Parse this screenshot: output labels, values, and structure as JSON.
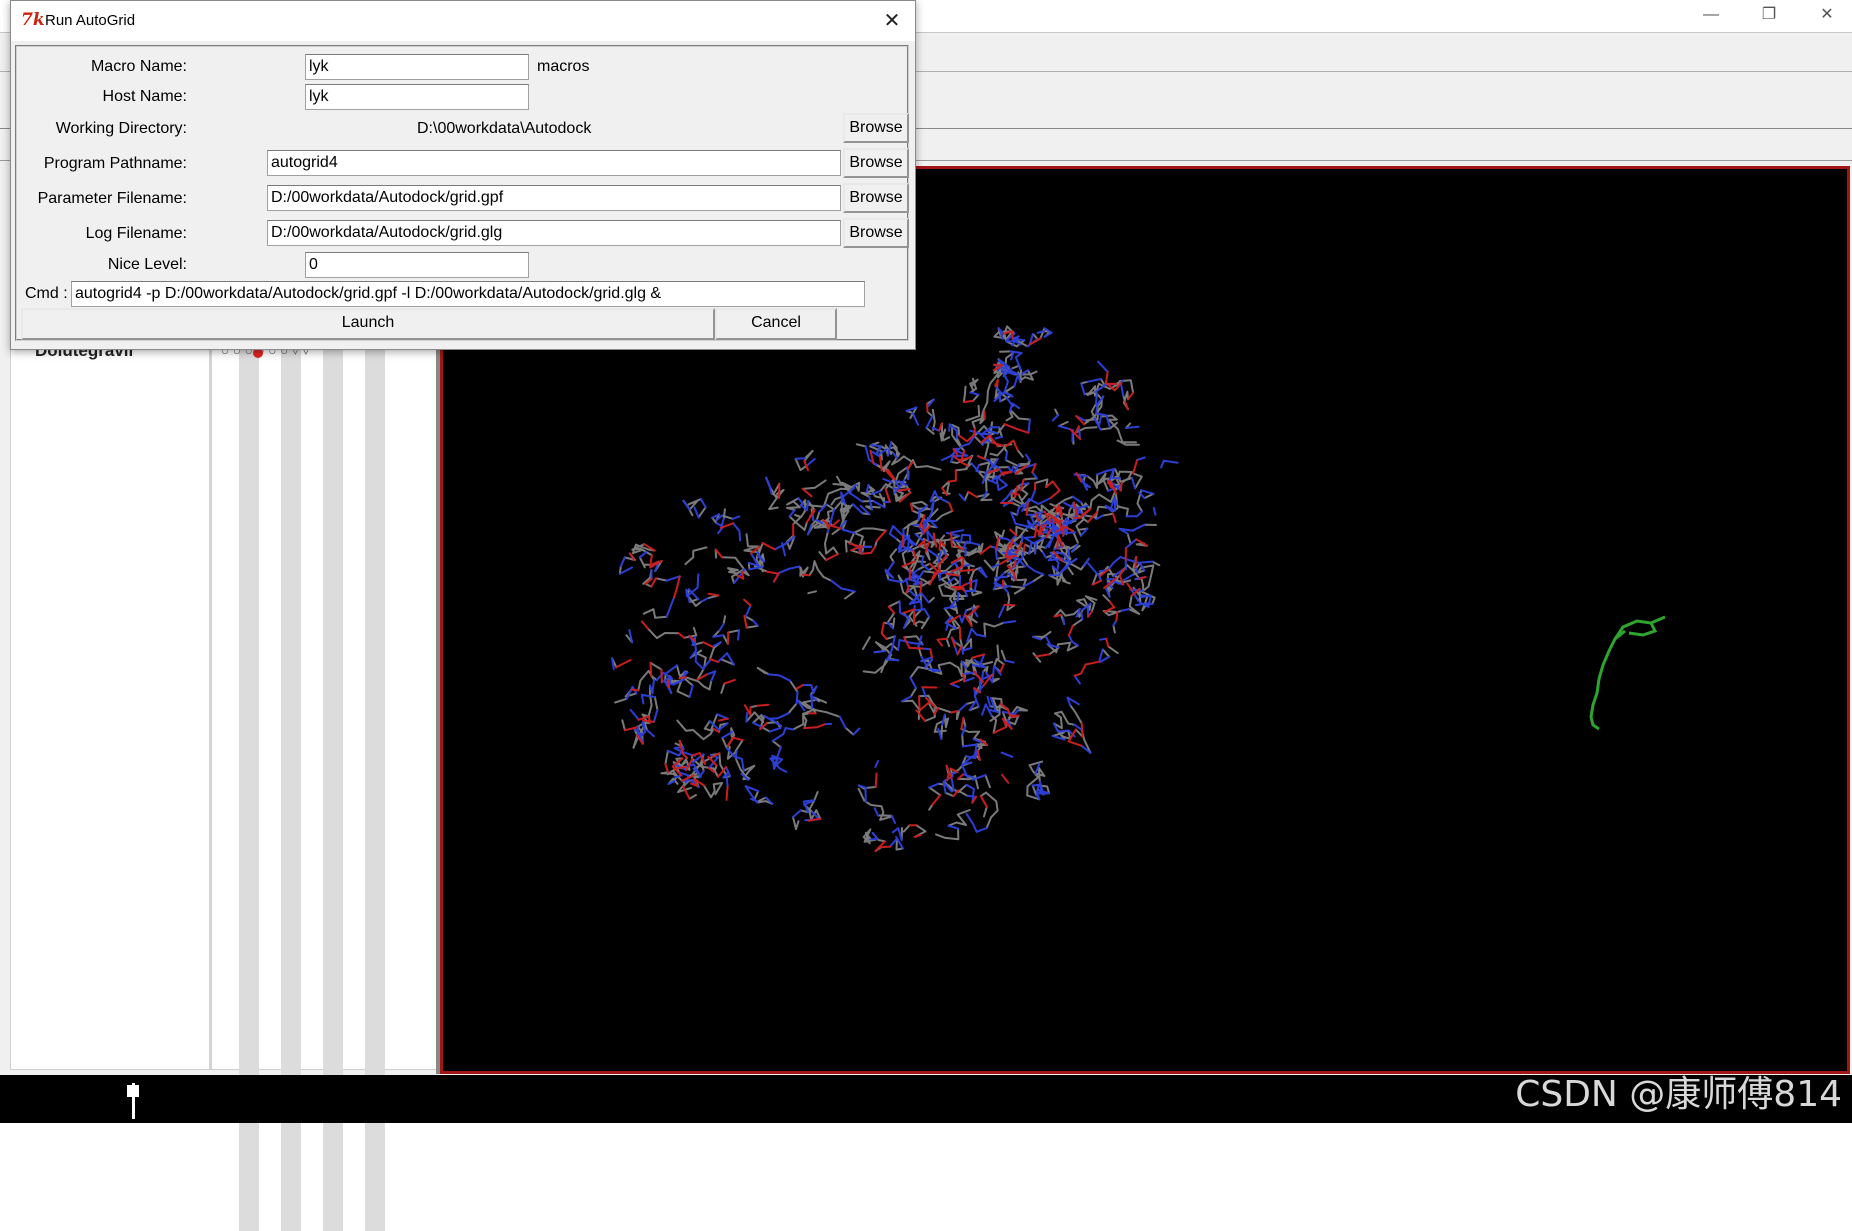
{
  "dialog": {
    "title": "Run AutoGrid",
    "logo_text": "7k",
    "fields": {
      "macro_name": {
        "label": "Macro Name:",
        "value": "lyk",
        "suffix": "macros"
      },
      "host_name": {
        "label": "Host Name:",
        "value": "lyk"
      },
      "working_directory": {
        "label": "Working Directory:",
        "value": "D:\\00workdata\\Autodock"
      },
      "program_pathname": {
        "label": "Program Pathname:",
        "value": "autogrid4"
      },
      "parameter_filename": {
        "label": "Parameter Filename:",
        "value": "D:/00workdata/Autodock/grid.gpf"
      },
      "log_filename": {
        "label": "Log Filename:",
        "value": "D:/00workdata/Autodock/grid.glg"
      },
      "nice_level": {
        "label": "Nice Level:",
        "value": "0"
      }
    },
    "browse_label": "Browse",
    "cmd_label": "Cmd :",
    "cmd_value": "autogrid4 -p D:/00workdata/Autodock/grid.gpf -l D:/00workdata/Autodock/grid.glg &",
    "launch_label": "Launch",
    "cancel_label": "Cancel"
  },
  "dashboard": {
    "molecule_name": "Dolutegravir"
  },
  "watermark": "CSDN @康师傅814",
  "colors": {
    "viewer_bg": "#000000",
    "viewer_border": "#a31414",
    "carbon": "#7a7a7a",
    "nitrogen": "#2b3fd6",
    "oxygen": "#c81e1e",
    "ligand": "#2ea52e"
  }
}
